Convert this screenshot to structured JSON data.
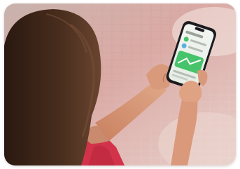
{
  "photo": {
    "kind": "photograph",
    "colors": {
      "background": "#d9a9a4",
      "hair": "#3a2418",
      "skin": "#d79a7c",
      "shirt": "#d2334a",
      "phone": "#1b1b1f",
      "screen_accent": "#47c36b"
    }
  }
}
